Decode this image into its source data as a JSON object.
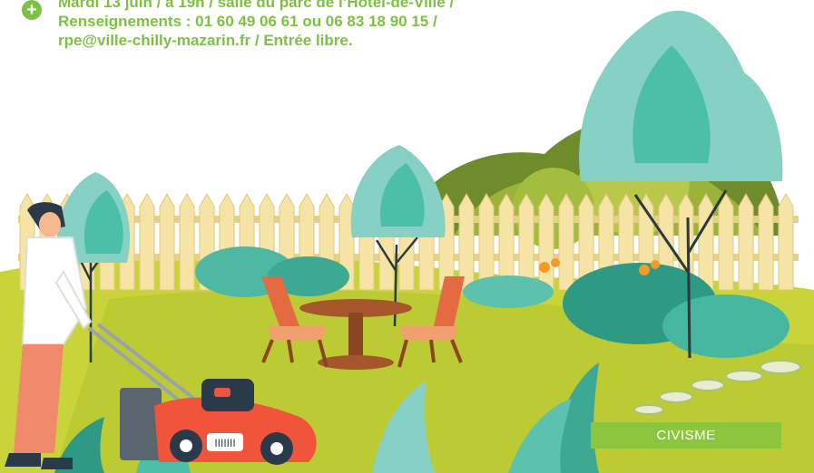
{
  "event_info": {
    "line1": "Mardi 13 juin / à 19h / salle du parc de l’Hôtel-de-Ville /",
    "line2": "Renseignements : 01 60 49 06 61 ou 06 83 18 90 15 /",
    "line3": "rpe@ville-chilly-mazarin.fr / Entrée libre."
  },
  "illustration": {
    "description_icon": "garden-mowing-illustration",
    "mower_plate": "IIIIIII"
  },
  "category_badge": {
    "label": "CIVISME",
    "color": "#8cc63f"
  },
  "colors": {
    "accent_green": "#7cc242",
    "lawn": "#c9d43a",
    "fence": "#f6e3a6",
    "mower": "#f0553c"
  }
}
